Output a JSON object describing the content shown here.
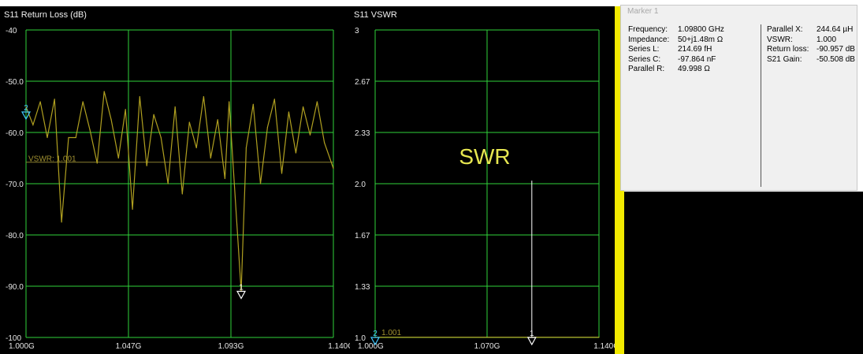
{
  "chart_data": [
    {
      "type": "line",
      "title": "S11 Return Loss (dB)",
      "x_ticks": [
        "1.000G",
        "1.047G",
        "1.093G",
        "1.140G"
      ],
      "y_ticks": [
        "-40",
        "-50.0",
        "-60.0",
        "-70.0",
        "-80.0",
        "-90.0",
        "-100"
      ],
      "xlim": [
        1.0,
        1.14
      ],
      "ylim": [
        -100,
        -40
      ],
      "grid": true,
      "series": [
        {
          "color": "#b0a020",
          "x": [
            1.0,
            1.0032,
            1.0065,
            1.0097,
            1.013,
            1.0162,
            1.0194,
            1.0227,
            1.0259,
            1.0291,
            1.0324,
            1.0356,
            1.0388,
            1.0421,
            1.0453,
            1.0485,
            1.0518,
            1.055,
            1.0582,
            1.0615,
            1.0647,
            1.0679,
            1.0712,
            1.0744,
            1.0776,
            1.0809,
            1.0841,
            1.0873,
            1.0906,
            1.0925,
            1.098,
            1.1003,
            1.1035,
            1.1068,
            1.11,
            1.1132,
            1.1165,
            1.1197,
            1.1229,
            1.1262,
            1.1294,
            1.1326,
            1.1359,
            1.14
          ],
          "values": [
            -55.0,
            -58.5,
            -54.0,
            -61.0,
            -53.5,
            -77.5,
            -61.0,
            -61.0,
            -54.0,
            -59.5,
            -66.0,
            -52.0,
            -57.5,
            -65.0,
            -55.5,
            -75.0,
            -53.0,
            -66.5,
            -56.5,
            -61.0,
            -70.0,
            -55.0,
            -72.0,
            -58.0,
            -63.0,
            -53.0,
            -65.0,
            -57.5,
            -69.0,
            -54.0,
            -91.0,
            -63.0,
            -54.5,
            -70.0,
            -59.0,
            -53.5,
            -68.0,
            -56.0,
            -64.0,
            -55.0,
            -60.5,
            -54.0,
            -62.0,
            -67.0
          ]
        }
      ],
      "reference_label": "VSWR: 1.001",
      "reference_value": -65.8,
      "markers": [
        {
          "label": "1",
          "x": 1.098,
          "y": -91.0,
          "color": "#ffffff"
        },
        {
          "label": "2",
          "x": 1.0,
          "y": -56.0,
          "color": "#40c8ff"
        }
      ]
    },
    {
      "type": "line",
      "title": "S11 VSWR",
      "x_ticks": [
        "1.000G",
        "1.070G",
        "1.140G"
      ],
      "y_ticks": [
        "3",
        "2.67",
        "2.33",
        "2.0",
        "1.67",
        "1.33",
        "1.0"
      ],
      "xlim": [
        1.0,
        1.14
      ],
      "ylim": [
        1.0,
        3.0
      ],
      "grid": true,
      "overlay_text": "SWR",
      "overlay_color": "#e6e650",
      "series": [
        {
          "color": "#c8c030",
          "x": [
            1.0,
            1.14
          ],
          "values": [
            1.001,
            1.001
          ]
        }
      ],
      "reference_label": "1.001",
      "markers": [
        {
          "label": "1",
          "x": 1.098,
          "y": 1.0,
          "color": "#ffffff"
        },
        {
          "label": "2",
          "x": 1.0,
          "y": 1.0,
          "color": "#40c8ff"
        }
      ],
      "marker_line": {
        "x": 1.098,
        "top": 2.02
      }
    }
  ],
  "marker_panel": {
    "title": "Marker 1",
    "left": [
      {
        "label": "Frequency:",
        "value": "1.09800 GHz"
      },
      {
        "label": "Impedance:",
        "value": "50+j1.48m Ω"
      },
      {
        "label": "Series L:",
        "value": "214.69 fH"
      },
      {
        "label": "Series C:",
        "value": "-97.864 nF"
      },
      {
        "label": "Parallel R:",
        "value": "49.998 Ω"
      }
    ],
    "right": [
      {
        "label": "Parallel X:",
        "value": "244.64 µH"
      },
      {
        "label": "VSWR:",
        "value": "1.000"
      },
      {
        "label": "Return loss:",
        "value": "-90.957 dB"
      },
      {
        "label": "S21 Gain:",
        "value": "-50.508 dB"
      }
    ]
  }
}
